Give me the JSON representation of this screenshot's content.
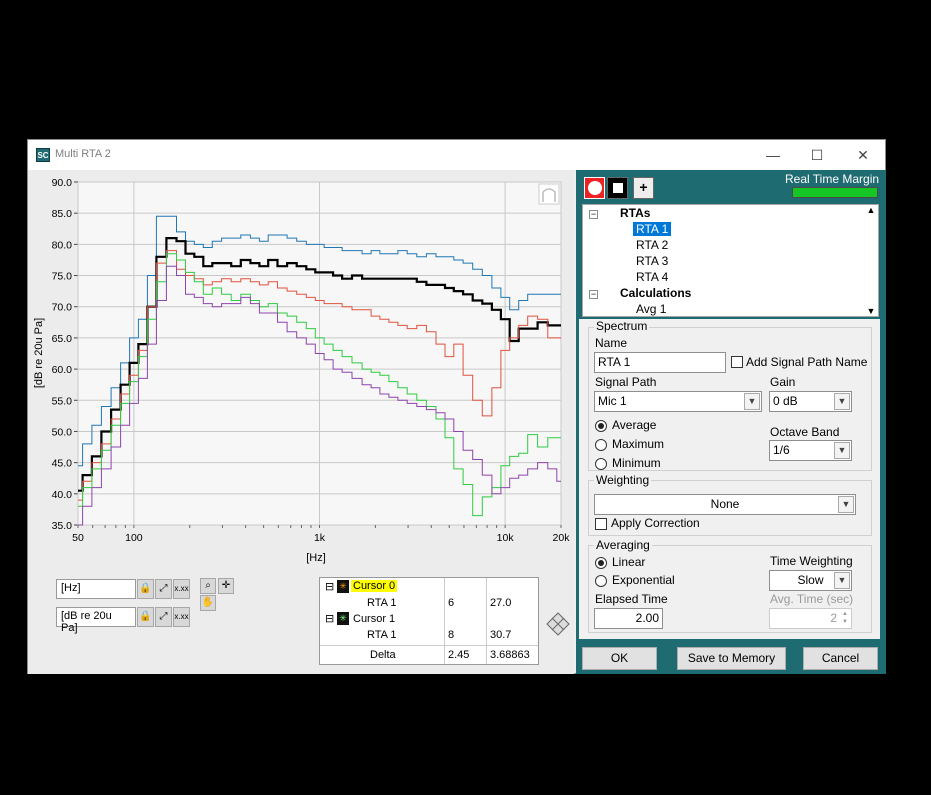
{
  "window": {
    "title": "Multi RTA 2",
    "app_icon_text": "SC",
    "controls": {
      "minimize": "—",
      "maximize": "☐",
      "close": "✕"
    }
  },
  "plot": {
    "ylabel": "[dB re 20u Pa]",
    "xlabel": "[Hz]",
    "y_ticks": [
      "90.0",
      "85.0",
      "80.0",
      "75.0",
      "70.0",
      "65.0",
      "60.0",
      "55.0",
      "50.0",
      "45.0",
      "40.0",
      "35.0"
    ],
    "x_ticks": [
      "50",
      "100",
      "1k",
      "10k",
      "20k"
    ]
  },
  "chart_data": {
    "type": "line",
    "xlabel": "[Hz]",
    "ylabel": "[dB re 20u Pa]",
    "xlim": [
      50,
      20000
    ],
    "ylim": [
      35,
      90
    ],
    "x_scale": "log",
    "x_ticks": [
      50,
      100,
      1000,
      10000,
      20000
    ],
    "x_tick_labels": [
      "50",
      "100",
      "1k",
      "10k",
      "20k"
    ],
    "y_ticks": [
      35,
      40,
      45,
      50,
      55,
      60,
      65,
      70,
      75,
      80,
      85,
      90
    ],
    "grid": true,
    "series": [
      {
        "color": "#1f77b4",
        "x": [
          50,
          56,
          63,
          71,
          80,
          90,
          100,
          112,
          125,
          140,
          160,
          180,
          200,
          224,
          250,
          280,
          315,
          355,
          400,
          450,
          500,
          560,
          630,
          710,
          800,
          900,
          1000,
          1120,
          1250,
          1400,
          1600,
          1800,
          2000,
          2240,
          2500,
          2800,
          3150,
          3550,
          4000,
          4500,
          5000,
          5600,
          6300,
          7100,
          8000,
          9000,
          10000,
          11200,
          12500,
          14000,
          16000,
          18000,
          20000
        ],
        "values": [
          44.5,
          48,
          51,
          54,
          57,
          61,
          65,
          68,
          75,
          84.5,
          84.5,
          82,
          80.5,
          80,
          79.5,
          80.5,
          81,
          81,
          81.5,
          81,
          80.5,
          81.5,
          81.5,
          81,
          80.5,
          80,
          80,
          79.5,
          79.5,
          79,
          79,
          78.5,
          79,
          78.5,
          78.5,
          79,
          78.5,
          78,
          78.5,
          78,
          78,
          77.5,
          77,
          76,
          75,
          73,
          71.5,
          69.5,
          71,
          72,
          72,
          72,
          72
        ]
      },
      {
        "color": "#000000",
        "x": [
          50,
          56,
          63,
          71,
          80,
          90,
          100,
          112,
          125,
          140,
          160,
          180,
          200,
          224,
          250,
          280,
          315,
          355,
          400,
          450,
          500,
          560,
          630,
          710,
          800,
          900,
          1000,
          1120,
          1250,
          1400,
          1600,
          1800,
          2000,
          2240,
          2500,
          2800,
          3150,
          3550,
          4000,
          4500,
          5000,
          5600,
          6300,
          7100,
          8000,
          9000,
          10000,
          11200,
          12500,
          14000,
          16000,
          18000,
          20000
        ],
        "values": [
          40.5,
          43,
          46,
          50,
          53.5,
          57.5,
          61,
          64,
          70,
          78,
          81,
          80.5,
          78.5,
          78,
          76.5,
          77,
          77,
          76.5,
          77.5,
          77,
          76.5,
          77.5,
          76.5,
          77,
          76.5,
          76,
          75.5,
          75.5,
          75,
          74.5,
          75,
          74.5,
          74.5,
          74.5,
          74.5,
          74.5,
          74.5,
          74,
          73.5,
          73.5,
          73,
          72.5,
          72,
          71,
          70.5,
          69.5,
          68,
          64.5,
          66.5,
          66.5,
          67.5,
          67,
          67
        ]
      },
      {
        "color": "#e0523e",
        "x": [
          50,
          56,
          63,
          71,
          80,
          90,
          100,
          112,
          125,
          140,
          160,
          180,
          200,
          224,
          250,
          280,
          315,
          355,
          400,
          450,
          500,
          560,
          630,
          710,
          800,
          900,
          1000,
          1120,
          1250,
          1400,
          1600,
          1800,
          2000,
          2240,
          2500,
          2800,
          3150,
          3550,
          4000,
          4500,
          5000,
          5600,
          6300,
          7100,
          8000,
          9000,
          10000,
          11200,
          12500,
          14000,
          16000,
          18000,
          20000
        ],
        "values": [
          39,
          42,
          45,
          48,
          52,
          56,
          59,
          63,
          70,
          77,
          79,
          76,
          75,
          74.5,
          73.5,
          74,
          74.5,
          74,
          74.5,
          74,
          73.5,
          74,
          73,
          72.5,
          72,
          71.5,
          71,
          70.5,
          70.5,
          70,
          69.5,
          69.5,
          68.5,
          68,
          67.5,
          67,
          66.5,
          67,
          66,
          64,
          62,
          64,
          59,
          55,
          52.5,
          57,
          63,
          65,
          67,
          68.5,
          68,
          65,
          65
        ]
      },
      {
        "color": "#2ecc40",
        "x": [
          50,
          56,
          63,
          71,
          80,
          90,
          100,
          112,
          125,
          140,
          160,
          180,
          200,
          224,
          250,
          280,
          315,
          355,
          400,
          450,
          500,
          560,
          630,
          710,
          800,
          900,
          1000,
          1120,
          1250,
          1400,
          1600,
          1800,
          2000,
          2240,
          2500,
          2800,
          3150,
          3550,
          4000,
          4500,
          5000,
          5600,
          6300,
          7100,
          8000,
          9000,
          10000,
          11200,
          12500,
          14000,
          16000,
          18000,
          20000
        ],
        "values": [
          38,
          41,
          44,
          47,
          51,
          54.5,
          58,
          62,
          68,
          74,
          78.5,
          77.5,
          75.5,
          74,
          72,
          73,
          72,
          71,
          72,
          71,
          70,
          70.5,
          69,
          68.5,
          67.5,
          66.5,
          65,
          64,
          63,
          62,
          61,
          60,
          59.5,
          59,
          58,
          57,
          56,
          55,
          54,
          52,
          49,
          44,
          41.5,
          36.5,
          39.5,
          41,
          44.5,
          46,
          46.5,
          49.5,
          47.5,
          49,
          49
        ]
      },
      {
        "color": "#8e44ad",
        "x": [
          50,
          56,
          63,
          71,
          80,
          90,
          100,
          112,
          125,
          140,
          160,
          180,
          200,
          224,
          250,
          280,
          315,
          355,
          400,
          450,
          500,
          560,
          630,
          710,
          800,
          900,
          1000,
          1120,
          1250,
          1400,
          1600,
          1800,
          2000,
          2240,
          2500,
          2800,
          3150,
          3550,
          4000,
          4500,
          5000,
          5600,
          6300,
          7100,
          8000,
          9000,
          10000,
          11200,
          12500,
          14000,
          16000,
          18000,
          20000
        ],
        "values": [
          35,
          38,
          41,
          44,
          47.5,
          51,
          54.5,
          58.5,
          64,
          71,
          76.5,
          75,
          72,
          71.5,
          70.5,
          70,
          70.5,
          70.5,
          71.5,
          70.5,
          69,
          69,
          67.5,
          66,
          65,
          64,
          62.5,
          61.5,
          60,
          59.5,
          58.5,
          57.5,
          57,
          56,
          55.5,
          55,
          54.5,
          54,
          53.5,
          53,
          52,
          50,
          47,
          45.5,
          43,
          40,
          41,
          42.5,
          43,
          44,
          45,
          44,
          42
        ]
      }
    ]
  },
  "scale_controls": {
    "x_unit": "[Hz]",
    "y_unit": "[dB re 20u Pa]",
    "lock_icon": "🔒",
    "format_icon": "x.xx",
    "zoom_icon": "⌕",
    "cursor_icon": "✛",
    "pan_icon": "✋"
  },
  "cursors": {
    "rows": [
      {
        "label": "Cursor 0",
        "value1": "",
        "value2": ""
      },
      {
        "label": "RTA 1",
        "value1": "6",
        "value2": "27.0"
      },
      {
        "label": "Cursor 1",
        "value1": "",
        "value2": ""
      },
      {
        "label": "RTA 1",
        "value1": "8",
        "value2": "30.7"
      },
      {
        "label": "Delta",
        "value1": "2.45",
        "value2": "3.68863"
      }
    ],
    "expander": "⊟"
  },
  "right": {
    "real_time_margin": "Real Time Margin",
    "meter_fraction": 1.0,
    "add_button": "+",
    "tree": {
      "groups": [
        {
          "label": "RTAs",
          "items": [
            "RTA 1",
            "RTA 2",
            "RTA 3",
            "RTA 4"
          ]
        },
        {
          "label": "Calculations",
          "items": [
            "Avg 1"
          ]
        }
      ],
      "selected": "RTA 1"
    }
  },
  "spectrum": {
    "group_label": "Spectrum",
    "name_label": "Name",
    "name_value": "RTA 1",
    "add_signal_path_name": "Add Signal Path Name",
    "signal_path_label": "Signal Path",
    "signal_path_value": "Mic 1",
    "gain_label": "Gain",
    "gain_value": "0 dB",
    "mode_average": "Average",
    "mode_maximum": "Maximum",
    "mode_minimum": "Minimum",
    "octave_band_label": "Octave Band",
    "octave_band_value": "1/6"
  },
  "weighting": {
    "group_label": "Weighting",
    "value": "None",
    "apply_correction": "Apply Correction"
  },
  "averaging": {
    "group_label": "Averaging",
    "linear": "Linear",
    "exponential": "Exponential",
    "time_weighting_label": "Time Weighting",
    "time_weighting_value": "Slow",
    "elapsed_time_label": "Elapsed Time",
    "elapsed_time_value": "2.00",
    "avg_time_label": "Avg. Time (sec)",
    "avg_time_value": "2"
  },
  "buttons": {
    "ok": "OK",
    "save": "Save to Memory",
    "cancel": "Cancel"
  },
  "colors": {
    "panel_teal": "#1f6b72",
    "selection": "#0078d7",
    "meter_green": "#16c624",
    "cursor_highlight": "#ffff00"
  }
}
